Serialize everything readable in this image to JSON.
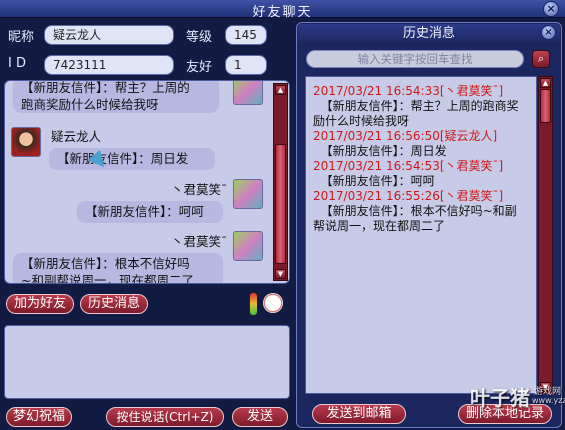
{
  "window": {
    "title": "好友聊天",
    "close_icon": "close-icon"
  },
  "profile": {
    "nickname_label": "昵称",
    "nickname_value": "疑云龙人",
    "level_label": "等级",
    "level_value": "145",
    "id_label": "I D",
    "id_value": "7423111",
    "friendship_label": "友好",
    "friendship_value": "1"
  },
  "chat": {
    "messages": [
      {
        "sender": "",
        "text_line1": "【新朋友信件】：帮主？上周的",
        "text_line2": "跑商奖励什么时候给我呀",
        "side": "right"
      },
      {
        "sender": "疑云龙人",
        "text": "【新朋友信件】：周日发",
        "side": "left"
      },
      {
        "sender": "丶君莫笑ˉ",
        "text": "【新朋友信件】：呵呵",
        "side": "right"
      },
      {
        "sender": "丶君莫笑ˉ",
        "text_line1": "【新朋友信件】：根本不信好吗",
        "text_line2": "~和副帮说周一，现在都周二了",
        "side": "right"
      }
    ]
  },
  "actions": {
    "add_friend": "加为好友",
    "history": "历史消息"
  },
  "bottom": {
    "dream_bless": "梦幻祝福",
    "hold_talk": "按住说话(Ctrl+Z)",
    "send": "发送"
  },
  "history": {
    "title": "历史消息",
    "search_placeholder": "输入关键字按回车查找",
    "entries": [
      {
        "ts": "2017/03/21 16:54:33[丶君莫笑ˉ]",
        "line1": "  【新朋友信件】：帮主？上周的跑商奖",
        "line2": "励什么时候给我呀"
      },
      {
        "ts": "2017/03/21 16:56:50[疑云龙人]",
        "line1": "  【新朋友信件】：周日发",
        "line2": ""
      },
      {
        "ts": "2017/03/21 16:54:53[丶君莫笑ˉ]",
        "line1": "  【新朋友信件】：呵呵",
        "line2": ""
      },
      {
        "ts": "2017/03/21 16:55:26[丶君莫笑ˉ]",
        "line1": "  【新朋友信件】：根本不信好吗~和副",
        "line2": "帮说周一，现在都周二了"
      }
    ],
    "send_mail": "发送到邮箱",
    "delete_local": "删除本地记录"
  },
  "watermark": {
    "text": "叶子猪",
    "sub": "游戏网",
    "url": "www.yzz.cn"
  },
  "colors": {
    "accent": "#7e1a2a",
    "timestamp": "#d01818",
    "frame": "#121b42"
  }
}
